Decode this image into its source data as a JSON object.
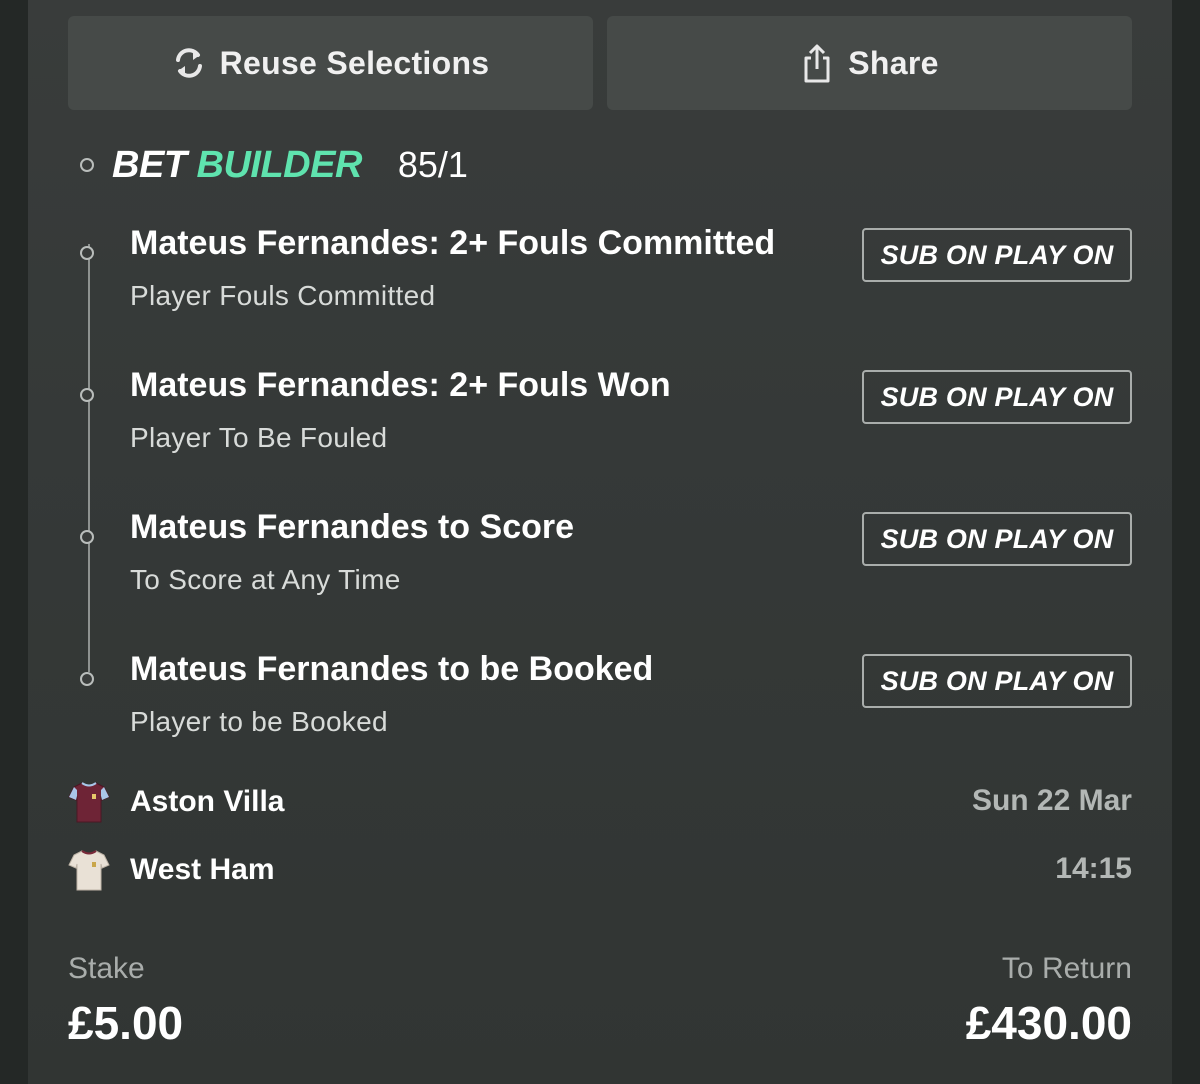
{
  "actions": {
    "reuse_label": "Reuse Selections",
    "reuse_icon": "refresh-icon",
    "share_label": "Share",
    "share_icon": "share-icon"
  },
  "bet_builder": {
    "title_bet": "BET",
    "title_builder": "BUILDER",
    "builder_color": "#5fe3ae",
    "odds": "85/1"
  },
  "legs": [
    {
      "title": "Mateus Fernandes: 2+ Fouls Committed",
      "market": "Player Fouls Committed",
      "badge": "SUB ON PLAY ON"
    },
    {
      "title": "Mateus Fernandes: 2+ Fouls Won",
      "market": "Player To Be Fouled",
      "badge": "SUB ON PLAY ON"
    },
    {
      "title": "Mateus Fernandes to Score",
      "market": "To Score at Any Time",
      "badge": "SUB ON PLAY ON"
    },
    {
      "title": "Mateus Fernandes to be Booked",
      "market": "Player to be Booked",
      "badge": "SUB ON PLAY ON"
    }
  ],
  "match": {
    "home_team": "Aston Villa",
    "home_shirt_icon": "aston-villa-shirt-icon",
    "away_team": "West Ham",
    "away_shirt_icon": "west-ham-shirt-icon",
    "date": "Sun 22 Mar",
    "time": "14:15"
  },
  "stake": {
    "label": "Stake",
    "value": "£5.00"
  },
  "to_return": {
    "label": "To Return",
    "value": "£430.00"
  }
}
